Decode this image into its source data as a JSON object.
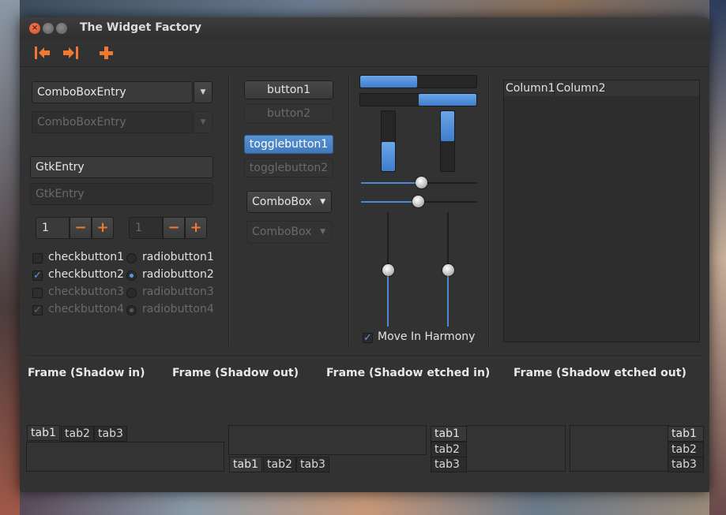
{
  "window": {
    "title": "The Widget Factory"
  },
  "toolbar": {
    "icons": [
      "go-first-icon",
      "go-last-icon",
      "add-icon"
    ]
  },
  "combos": {
    "entry1": "ComboBoxEntry",
    "entry2": "ComboBoxEntry"
  },
  "entries": {
    "entry1": "GtkEntry",
    "entry2": "GtkEntry"
  },
  "spins": {
    "spin1": "1",
    "spin2": "1",
    "minus": "−",
    "plus": "+"
  },
  "checks": [
    {
      "label": "checkbutton1",
      "checked": false,
      "enabled": true
    },
    {
      "label": "checkbutton2",
      "checked": true,
      "enabled": true
    },
    {
      "label": "checkbutton3",
      "checked": false,
      "enabled": false
    },
    {
      "label": "checkbutton4",
      "checked": true,
      "enabled": false
    }
  ],
  "radios": [
    {
      "label": "radiobutton1",
      "checked": false,
      "enabled": true
    },
    {
      "label": "radiobutton2",
      "checked": true,
      "enabled": true
    },
    {
      "label": "radiobutton3",
      "checked": false,
      "enabled": false
    },
    {
      "label": "radiobutton4",
      "checked": true,
      "enabled": false
    }
  ],
  "buttons": {
    "button1": "button1",
    "button2": "button2",
    "toggle1": "togglebutton1",
    "toggle2": "togglebutton2",
    "combo1": "ComboBox",
    "combo2": "ComboBox"
  },
  "progress": {
    "bar1": 0.5,
    "bar2": 0.5
  },
  "vprogress": {
    "bar1": 0.5,
    "bar2": 0.5
  },
  "harmony": {
    "label": "Move In Harmony",
    "checked": true
  },
  "tree": {
    "columns": [
      "Column1",
      "Column2"
    ]
  },
  "frames": [
    "Frame (Shadow in)",
    "Frame (Shadow out)",
    "Frame (Shadow etched in)",
    "Frame (Shadow etched out)"
  ],
  "notebooks": {
    "tabs": [
      "tab1",
      "tab2",
      "tab3"
    ]
  },
  "colors": {
    "accent": "#4a8ad4",
    "spin_icon": "#f07830",
    "window_bg": "#323232"
  }
}
